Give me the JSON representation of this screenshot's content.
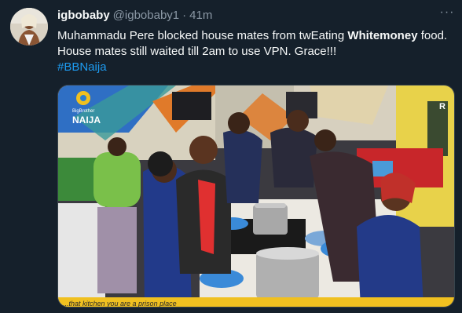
{
  "author": {
    "name": "igbobaby",
    "handle": "@igbobaby1",
    "separator": "·",
    "time": "41m",
    "avatar_icon": "profile-avatar"
  },
  "more_icon": "ellipsis-icon",
  "more_label": "···",
  "tweet": {
    "line1_pre": "Muhammadu Pere blocked house mates from twEating ",
    "line1_bold": "Whitemoney",
    "line1_post": " food.",
    "line2": "House mates still waited till 2am to use VPN. Grace!!!",
    "hashtag": "#BBNaija"
  },
  "media": {
    "description_icon": "tv-screenshot-image",
    "logo_line1": "BigBrother",
    "logo_line2": "NAIJA",
    "corner_tag": "R",
    "ticker_text": "...that kitchen you are a prison place",
    "colors": {
      "wall_left": "#d8d2bf",
      "wall_orange": "#e07a2a",
      "wall_blue": "#3a7fd0",
      "red_sofa": "#c8262a",
      "yellow_wall": "#e8d24a",
      "ticker": "#f0c020"
    }
  }
}
